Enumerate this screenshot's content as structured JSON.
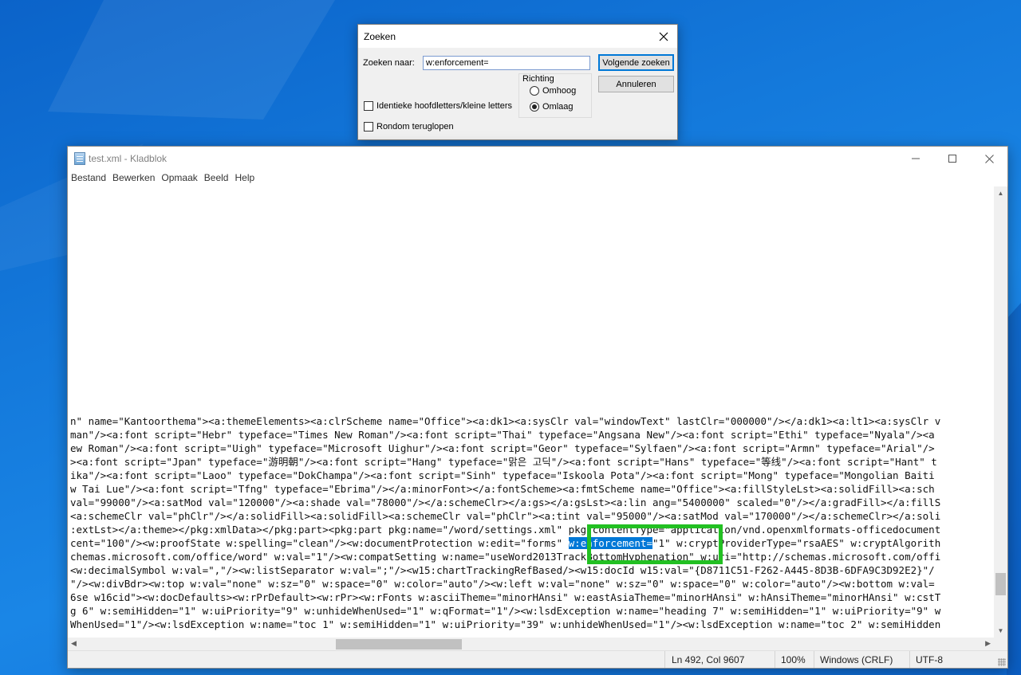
{
  "find_dialog": {
    "title": "Zoeken",
    "find_label": "Zoeken naar:",
    "find_value": "w:enforcement=",
    "find_next_button": "Volgende zoeken",
    "cancel_button": "Annuleren",
    "direction_group_label": "Richting",
    "direction_up": "Omhoog",
    "direction_down": "Omlaag",
    "direction_selected": "Omlaag",
    "match_case_label": "Identieke hoofdletters/kleine letters",
    "match_case_checked": false,
    "wrap_around_label": "Rondom teruglopen",
    "wrap_around_checked": false
  },
  "notepad": {
    "title": "test.xml - Kladblok",
    "menu": [
      "Bestand",
      "Bewerken",
      "Opmaak",
      "Beeld",
      "Help"
    ],
    "lines": [
      "n\" name=\"Kantoorthema\"><a:themeElements><a:clrScheme name=\"Office\"><a:dk1><a:sysClr val=\"windowText\" lastClr=\"000000\"/></a:dk1><a:lt1><a:sysClr v",
      "man\"/><a:font script=\"Hebr\" typeface=\"Times New Roman\"/><a:font script=\"Thai\" typeface=\"Angsana New\"/><a:font script=\"Ethi\" typeface=\"Nyala\"/><a",
      "ew Roman\"/><a:font script=\"Uigh\" typeface=\"Microsoft Uighur\"/><a:font script=\"Geor\" typeface=\"Sylfaen\"/><a:font script=\"Armn\" typeface=\"Arial\"/>",
      "><a:font script=\"Jpan\" typeface=\"游明朝\"/><a:font script=\"Hang\" typeface=\"맑은 고딕\"/><a:font script=\"Hans\" typeface=\"等线\"/><a:font script=\"Hant\" t",
      "ika\"/><a:font script=\"Laoo\" typeface=\"DokChampa\"/><a:font script=\"Sinh\" typeface=\"Iskoola Pota\"/><a:font script=\"Mong\" typeface=\"Mongolian Baiti",
      "w Tai Lue\"/><a:font script=\"Tfng\" typeface=\"Ebrima\"/></a:minorFont></a:fontScheme><a:fmtScheme name=\"Office\"><a:fillStyleLst><a:solidFill><a:sch",
      "val=\"99000\"/><a:satMod val=\"120000\"/><a:shade val=\"78000\"/></a:schemeClr></a:gs></a:gsLst><a:lin ang=\"5400000\" scaled=\"0\"/></a:gradFill></a:fillS",
      "<a:schemeClr val=\"phClr\"/></a:solidFill><a:solidFill><a:schemeClr val=\"phClr\"><a:tint val=\"95000\"/><a:satMod val=\"170000\"/></a:schemeClr></a:soli",
      ":extLst></a:theme></pkg:xmlData></pkg:part><pkg:part pkg:name=\"/word/settings.xml\" pkg:contentType=\"application/vnd.openxmlformats-officedocument",
      "cent=\"100\"/><w:proofState w:spelling=\"clean\"/><w:documentProtection w:edit=\"forms\" ",
      "chemas.microsoft.com/office/word\" w:val=\"1\"/><w:compatSetting w:name=\"useWord2013TrackBottomHyphenation\" w:uri=\"http://schemas.microsoft.com/offi",
      "<w:decimalSymbol w:val=\",\"/><w:listSeparator w:val=\";\"/><w15:chartTrackingRefBased/><w15:docId w15:val=\"{D8711C51-F262-A445-8D3B-6DFA9C3D92E2}\"/",
      "\"/><w:divBdr><w:top w:val=\"none\" w:sz=\"0\" w:space=\"0\" w:color=\"auto\"/><w:left w:val=\"none\" w:sz=\"0\" w:space=\"0\" w:color=\"auto\"/><w:bottom w:val=",
      "6se w16cid\"><w:docDefaults><w:rPrDefault><w:rPr><w:rFonts w:asciiTheme=\"minorHAnsi\" w:eastAsiaTheme=\"minorHAnsi\" w:hAnsiTheme=\"minorHAnsi\" w:cstT",
      "g 6\" w:semiHidden=\"1\" w:uiPriority=\"9\" w:unhideWhenUsed=\"1\" w:qFormat=\"1\"/><w:lsdException w:name=\"heading 7\" w:semiHidden=\"1\" w:uiPriority=\"9\" w",
      "WhenUsed=\"1\"/><w:lsdException w:name=\"toc 1\" w:semiHidden=\"1\" w:uiPriority=\"39\" w:unhideWhenUsed=\"1\"/><w:lsdException w:name=\"toc 2\" w:semiHidden",
      "                                                                                                                                        "
    ],
    "selected_match": "w:enforcement=",
    "after_match": "\"1\" w:cryptProviderType=\"rsaAES\" w:cryptAlgorith",
    "status": {
      "position": "Ln 492, Col 9607",
      "zoom": "100%",
      "line_endings": "Windows (CRLF)",
      "encoding": "UTF-8"
    }
  },
  "colors": {
    "highlight_box": "#22c022",
    "selection": "#0078d7"
  }
}
